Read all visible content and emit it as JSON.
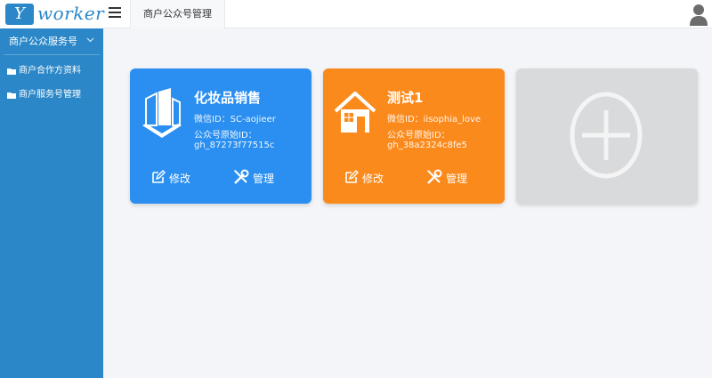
{
  "header": {
    "logo_letter": "Y",
    "logo_text": "worker",
    "tab_label": "商户公众号管理"
  },
  "sidebar": {
    "group_label": "商户公众服务号",
    "items": [
      {
        "label": "商户合作方资料"
      },
      {
        "label": "商户服务号管理"
      }
    ]
  },
  "cards": [
    {
      "title": "化妆品销售",
      "wechat_id": "微信ID：SC-aojieer",
      "origin_label": "公众号原始ID：",
      "origin_id": "gh_87273f77515c",
      "edit_label": "修改",
      "manage_label": "管理",
      "icon": "buildings-icon",
      "color": "#2a8ff0"
    },
    {
      "title": "测试1",
      "wechat_id": "微信ID：iisophia_love",
      "origin_label": "公众号原始ID：",
      "origin_id": "gh_38a2324c8fe5",
      "edit_label": "修改",
      "manage_label": "管理",
      "icon": "house-icon",
      "color": "#fb8a1c"
    }
  ],
  "add_card": {
    "icon": "plus-circle-icon",
    "color": "#d9dadc"
  },
  "colors": {
    "sidebar": "#2b87c7",
    "background": "#f4f5f8"
  }
}
